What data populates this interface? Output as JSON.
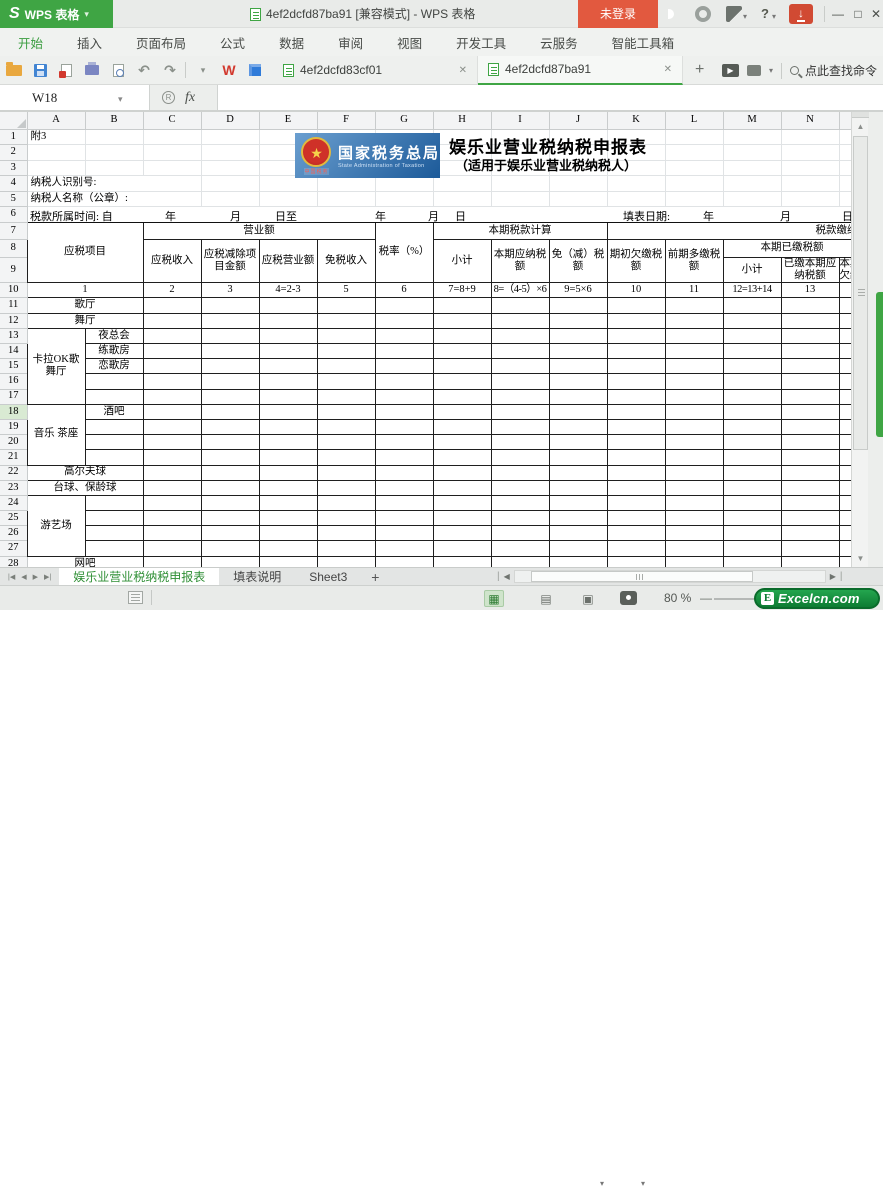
{
  "titlebar": {
    "app": "WPS 表格",
    "title": "4ef2dcfd87ba91 [兼容模式] - WPS 表格",
    "login": "未登录"
  },
  "menus": {
    "items": [
      "开始",
      "插入",
      "页面布局",
      "公式",
      "数据",
      "审阅",
      "视图",
      "开发工具",
      "云服务",
      "智能工具箱"
    ],
    "active_index": 0
  },
  "quickbar": {
    "tabs": [
      {
        "label": "4ef2dcfd83cf01"
      },
      {
        "label": "4ef2dcfd87ba91"
      }
    ],
    "search_placeholder": "点此查找命令"
  },
  "formula_bar": {
    "name_box": "W18",
    "fx": "fx",
    "stamp": "R"
  },
  "banner": {
    "star": "★",
    "org_cn": "国家税务总局",
    "org_en": "State Administration of Taxation",
    "stamp": "中国税务"
  },
  "form_title": {
    "title": "娱乐业营业税纳税申报表",
    "subtitle": "（适用于娱乐业营业税纳税人）"
  },
  "period_fields": [
    "税款所属时间: 自",
    "年",
    "月",
    "日至",
    "年",
    "月",
    "日",
    "填表日期:",
    "年",
    "月",
    "日"
  ],
  "icons": {
    "caret_down": "▾",
    "undo": "↶",
    "redo": "↷",
    "close_tab": "✕",
    "plus": "+",
    "window_min": "—",
    "window_max": "□",
    "window_close": "✕",
    "help": "?",
    "nav_first": "|◀",
    "nav_prev": "◀",
    "nav_next": "▶",
    "nav_last": "▶|",
    "scroll_left": "◀",
    "scroll_right": "▶",
    "scroll_up": "▲",
    "scroll_down": "▼",
    "hsep": "|",
    "minus": "—",
    "s_logo": "S",
    "w_logo": "W",
    "e_logo": "E",
    "present_play": "▶"
  },
  "sheet": {
    "col_labels": [
      "A",
      "B",
      "C",
      "D",
      "E",
      "F",
      "G",
      "H",
      "I",
      "J",
      "K",
      "L",
      "M",
      "N"
    ],
    "grid": [
      {
        "n": "1",
        "h": "A",
        "d": "g",
        "cells": [
          {
            "t": "附3",
            "c": "left b"
          }
        ]
      },
      {
        "n": "2",
        "h": "A",
        "d": "g"
      },
      {
        "n": "3",
        "h": "A",
        "d": "g"
      },
      {
        "n": "4",
        "h": "A",
        "d": "g",
        "cells": [
          {
            "t": "纳税人识别号:",
            "cs": 3,
            "c": "left"
          }
        ]
      },
      {
        "n": "5",
        "h": "A",
        "d": "g",
        "cells": [
          {
            "t": "纳税人名称（公章）:",
            "cs": 3,
            "c": "left"
          }
        ]
      },
      {
        "n": "6",
        "h": "A",
        "d": "g",
        "cells": [
          {
            "t": "",
            "cs": 15,
            "c": "pbot"
          }
        ]
      },
      {
        "n": "7",
        "h": "B",
        "d": "f",
        "cells": [
          {
            "t": "应税项目",
            "cs": 2,
            "rs": 3
          },
          {
            "t": "营业额",
            "cs": 4
          },
          {
            "t": "税率（%）",
            "rs": 3,
            "c": "nw"
          },
          {
            "t": "本期税款计算",
            "cs": 3
          },
          {
            "t": "税款缴纳",
            "cs": 5,
            "c": "clipr"
          }
        ]
      },
      {
        "n": "8",
        "h": "B",
        "d": "f",
        "cells": [
          {
            "t": "应税收入",
            "rs": 2
          },
          {
            "t": "应税减除项目金额",
            "rs": 2
          },
          {
            "t": "应税营业额",
            "rs": 2
          },
          {
            "t": "免税收入",
            "rs": 2
          },
          {
            "t": "小计",
            "rs": 2
          },
          {
            "t": "本期应纳税额",
            "rs": 2
          },
          {
            "t": "免（减）税额",
            "rs": 2
          },
          {
            "t": "期初欠缴税额",
            "rs": 2
          },
          {
            "t": "前期多缴税额",
            "rs": 2
          },
          {
            "t": "本期已缴税额",
            "cs": 3
          }
        ]
      },
      {
        "n": "9",
        "h": "B",
        "d": "f",
        "cells": [
          {
            "t": "小计"
          },
          {
            "t": "已缴本期应纳税额",
            "c": "tiny"
          },
          {
            "t": "本期 欠缴",
            "c": "tiny clipo"
          }
        ]
      },
      {
        "n": "10",
        "h": "C",
        "d": "f",
        "cells": [
          {
            "t": "1",
            "cs": 2
          },
          {
            "t": "2"
          },
          {
            "t": "3"
          },
          {
            "t": "4=2-3"
          },
          {
            "t": "5"
          },
          {
            "t": "6"
          },
          {
            "t": "7=8+9"
          },
          {
            "t": "8=（4-5）×6",
            "c": "sm"
          },
          {
            "t": "9=5×6"
          },
          {
            "t": "10"
          },
          {
            "t": "11"
          },
          {
            "t": "12=13+14",
            "c": "sm"
          },
          {
            "t": "13"
          },
          {
            "t": ""
          }
        ]
      },
      {
        "n": "11",
        "h": "D",
        "d": "f",
        "cells": [
          {
            "t": "歌厅",
            "cs": 2
          }
        ]
      },
      {
        "n": "12",
        "h": "D",
        "d": "f",
        "cells": [
          {
            "t": "舞厅",
            "cs": 2
          }
        ]
      },
      {
        "n": "13",
        "h": "D",
        "d": "f",
        "cells": [
          {
            "t": "卡拉OK歌舞厅",
            "rs": 5,
            "c": "wrap"
          },
          {
            "t": "夜总会"
          }
        ]
      },
      {
        "n": "14",
        "h": "D",
        "d": "f",
        "cells": [
          {
            "t": "练歌房"
          }
        ]
      },
      {
        "n": "15",
        "h": "D",
        "d": "f",
        "cells": [
          {
            "t": "恋歌房"
          }
        ]
      },
      {
        "n": "16",
        "h": "D",
        "d": "f"
      },
      {
        "n": "17",
        "h": "D",
        "d": "f"
      },
      {
        "n": "18",
        "h": "D",
        "d": "f",
        "hl": true,
        "cells": [
          {
            "t": "音乐  茶座",
            "rs": 4,
            "c": "wrap"
          },
          {
            "t": "酒吧"
          }
        ]
      },
      {
        "n": "19",
        "h": "D",
        "d": "f"
      },
      {
        "n": "20",
        "h": "D",
        "d": "f"
      },
      {
        "n": "21",
        "h": "D",
        "d": "f"
      },
      {
        "n": "22",
        "h": "D",
        "d": "f",
        "cells": [
          {
            "t": "高尔夫球",
            "cs": 2
          }
        ]
      },
      {
        "n": "23",
        "h": "D",
        "d": "f",
        "cells": [
          {
            "t": "台球、保龄球",
            "cs": 2
          }
        ]
      },
      {
        "n": "24",
        "h": "D",
        "d": "f",
        "cells": [
          {
            "t": "游艺场",
            "rs": 4
          }
        ]
      },
      {
        "n": "25",
        "h": "D",
        "d": "f"
      },
      {
        "n": "26",
        "h": "D",
        "d": "f"
      },
      {
        "n": "27",
        "h": "D",
        "d": "f"
      },
      {
        "n": "28",
        "h": "D",
        "d": "f",
        "cells": [
          {
            "t": "网吧",
            "cs": 2
          }
        ]
      },
      {
        "n": "",
        "h": "E",
        "d": "g"
      }
    ]
  },
  "sheet_tabs": {
    "tabs": [
      "娱乐业营业税纳税申报表",
      "填表说明",
      "Sheet3"
    ],
    "active_index": 0
  },
  "status_bar": {
    "zoom_level": "80 %",
    "watermark": "Excelcn.com"
  }
}
